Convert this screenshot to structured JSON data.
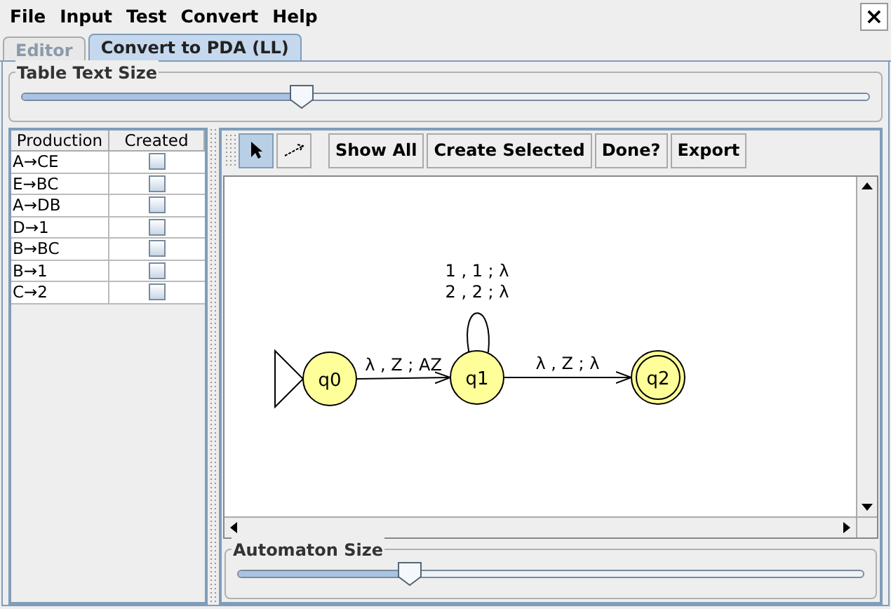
{
  "menu": [
    "File",
    "Input",
    "Test",
    "Convert",
    "Help"
  ],
  "close_label": "×",
  "tabs": [
    {
      "label": "Editor",
      "selected": false
    },
    {
      "label": "Convert to PDA (LL)",
      "selected": true
    }
  ],
  "table_text_size": {
    "label": "Table Text Size",
    "level": 0.33
  },
  "table": {
    "columns": [
      "Production",
      "Created"
    ],
    "rows": [
      {
        "production": "A→CE",
        "created": false
      },
      {
        "production": "E→BC",
        "created": false
      },
      {
        "production": "A→DB",
        "created": false
      },
      {
        "production": "D→1",
        "created": false
      },
      {
        "production": "B→BC",
        "created": false
      },
      {
        "production": "B→1",
        "created": false
      },
      {
        "production": "C→2",
        "created": false
      }
    ]
  },
  "tools": [
    {
      "kind": "pointer",
      "selected": true
    },
    {
      "kind": "transition",
      "selected": false
    }
  ],
  "buttons": [
    "Show All",
    "Create Selected",
    "Done?",
    "Export"
  ],
  "automaton": {
    "states": [
      {
        "name": "q0",
        "initial": true,
        "final": false
      },
      {
        "name": "q1",
        "initial": false,
        "final": false
      },
      {
        "name": "q2",
        "initial": false,
        "final": true
      }
    ],
    "transitions": [
      {
        "labels": [
          "λ , Z ; AZ"
        ]
      },
      {
        "labels": [
          "1 , 1 ; λ",
          "2 , 2 ; λ"
        ]
      },
      {
        "labels": [
          "λ , Z ; λ"
        ]
      }
    ]
  },
  "automaton_size": {
    "label": "Automaton Size",
    "level": 0.275
  }
}
